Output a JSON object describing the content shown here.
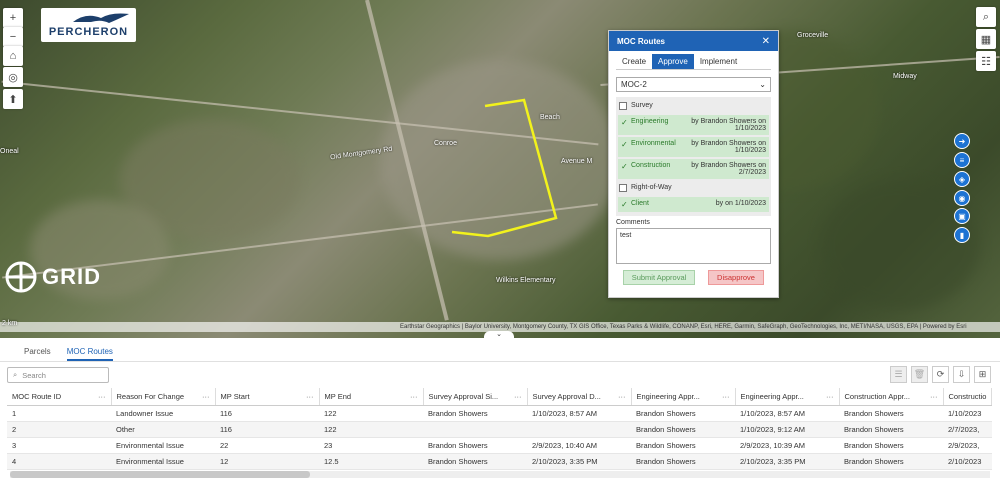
{
  "map": {
    "logo_text": "PERCHERON",
    "grid_logo_text": "GRID",
    "attribution": "Earthstar Geographics | Baylor University, Montgomery County, TX GIS Office, Texas Parks & Wildlife, CONANP, Esri, HERE, Garmin, SafeGraph, GeoTechnologies, Inc, METI/NASA, USGS, EPA",
    "powered_by": "Powered by Esri",
    "scale": "2 km",
    "labels": [
      "Conroe",
      "Groceville",
      "Midway",
      "Oneal",
      "Old Montgomery Rd",
      "Beach",
      "Avenue M",
      "Wilkins Elementary"
    ],
    "zoom_in": "+",
    "zoom_out": "−"
  },
  "panel": {
    "title": "MOC Routes",
    "close": "✕",
    "tabs": [
      "Create",
      "Approve",
      "Implement"
    ],
    "active_tab": "Approve",
    "selected_route": "MOC-2",
    "items": [
      {
        "name": "Survey",
        "status": "unchecked",
        "by": ""
      },
      {
        "name": "Engineering",
        "status": "approved",
        "by": "by Brandon Showers on 1/10/2023"
      },
      {
        "name": "Environmental",
        "status": "approved",
        "by": "by Brandon Showers on 1/10/2023"
      },
      {
        "name": "Construction",
        "status": "approved",
        "by": "by Brandon Showers on 2/7/2023"
      },
      {
        "name": "Right-of-Way",
        "status": "unchecked",
        "by": ""
      },
      {
        "name": "Client",
        "status": "approved",
        "by": "by on 1/10/2023"
      }
    ],
    "comments_label": "Comments",
    "comments_value": "test",
    "submit_label": "Submit Approval",
    "disapprove_label": "Disapprove"
  },
  "bottom": {
    "tabs": [
      "Parcels",
      "MOC Routes"
    ],
    "active_tab": "MOC Routes",
    "search_placeholder": "Search",
    "columns": [
      "MOC Route ID",
      "Reason For Change",
      "MP Start",
      "MP End",
      "Survey Approval Si...",
      "Survey Approval D...",
      "Engineering Appr...",
      "Engineering Appr...",
      "Construction Appr...",
      "Constructio"
    ],
    "rows": [
      [
        "1",
        "Landowner Issue",
        "116",
        "122",
        "Brandon Showers",
        "1/10/2023, 8:57 AM",
        "Brandon Showers",
        "1/10/2023, 8:57 AM",
        "Brandon Showers",
        "1/10/2023"
      ],
      [
        "2",
        "Other",
        "116",
        "122",
        "",
        "",
        "Brandon Showers",
        "1/10/2023, 9:12 AM",
        "Brandon Showers",
        "2/7/2023,"
      ],
      [
        "3",
        "Environmental Issue",
        "22",
        "23",
        "Brandon Showers",
        "2/9/2023, 10:40 AM",
        "Brandon Showers",
        "2/9/2023, 10:39 AM",
        "Brandon Showers",
        "2/9/2023,"
      ],
      [
        "4",
        "Environmental Issue",
        "12",
        "12.5",
        "Brandon Showers",
        "2/10/2023, 3:35 PM",
        "Brandon Showers",
        "2/10/2023, 3:35 PM",
        "Brandon Showers",
        "2/10/2023"
      ]
    ]
  },
  "colors": {
    "accent": "#1f63b5",
    "route": "#f2f21c",
    "approved_bg": "#cfe9cf"
  }
}
